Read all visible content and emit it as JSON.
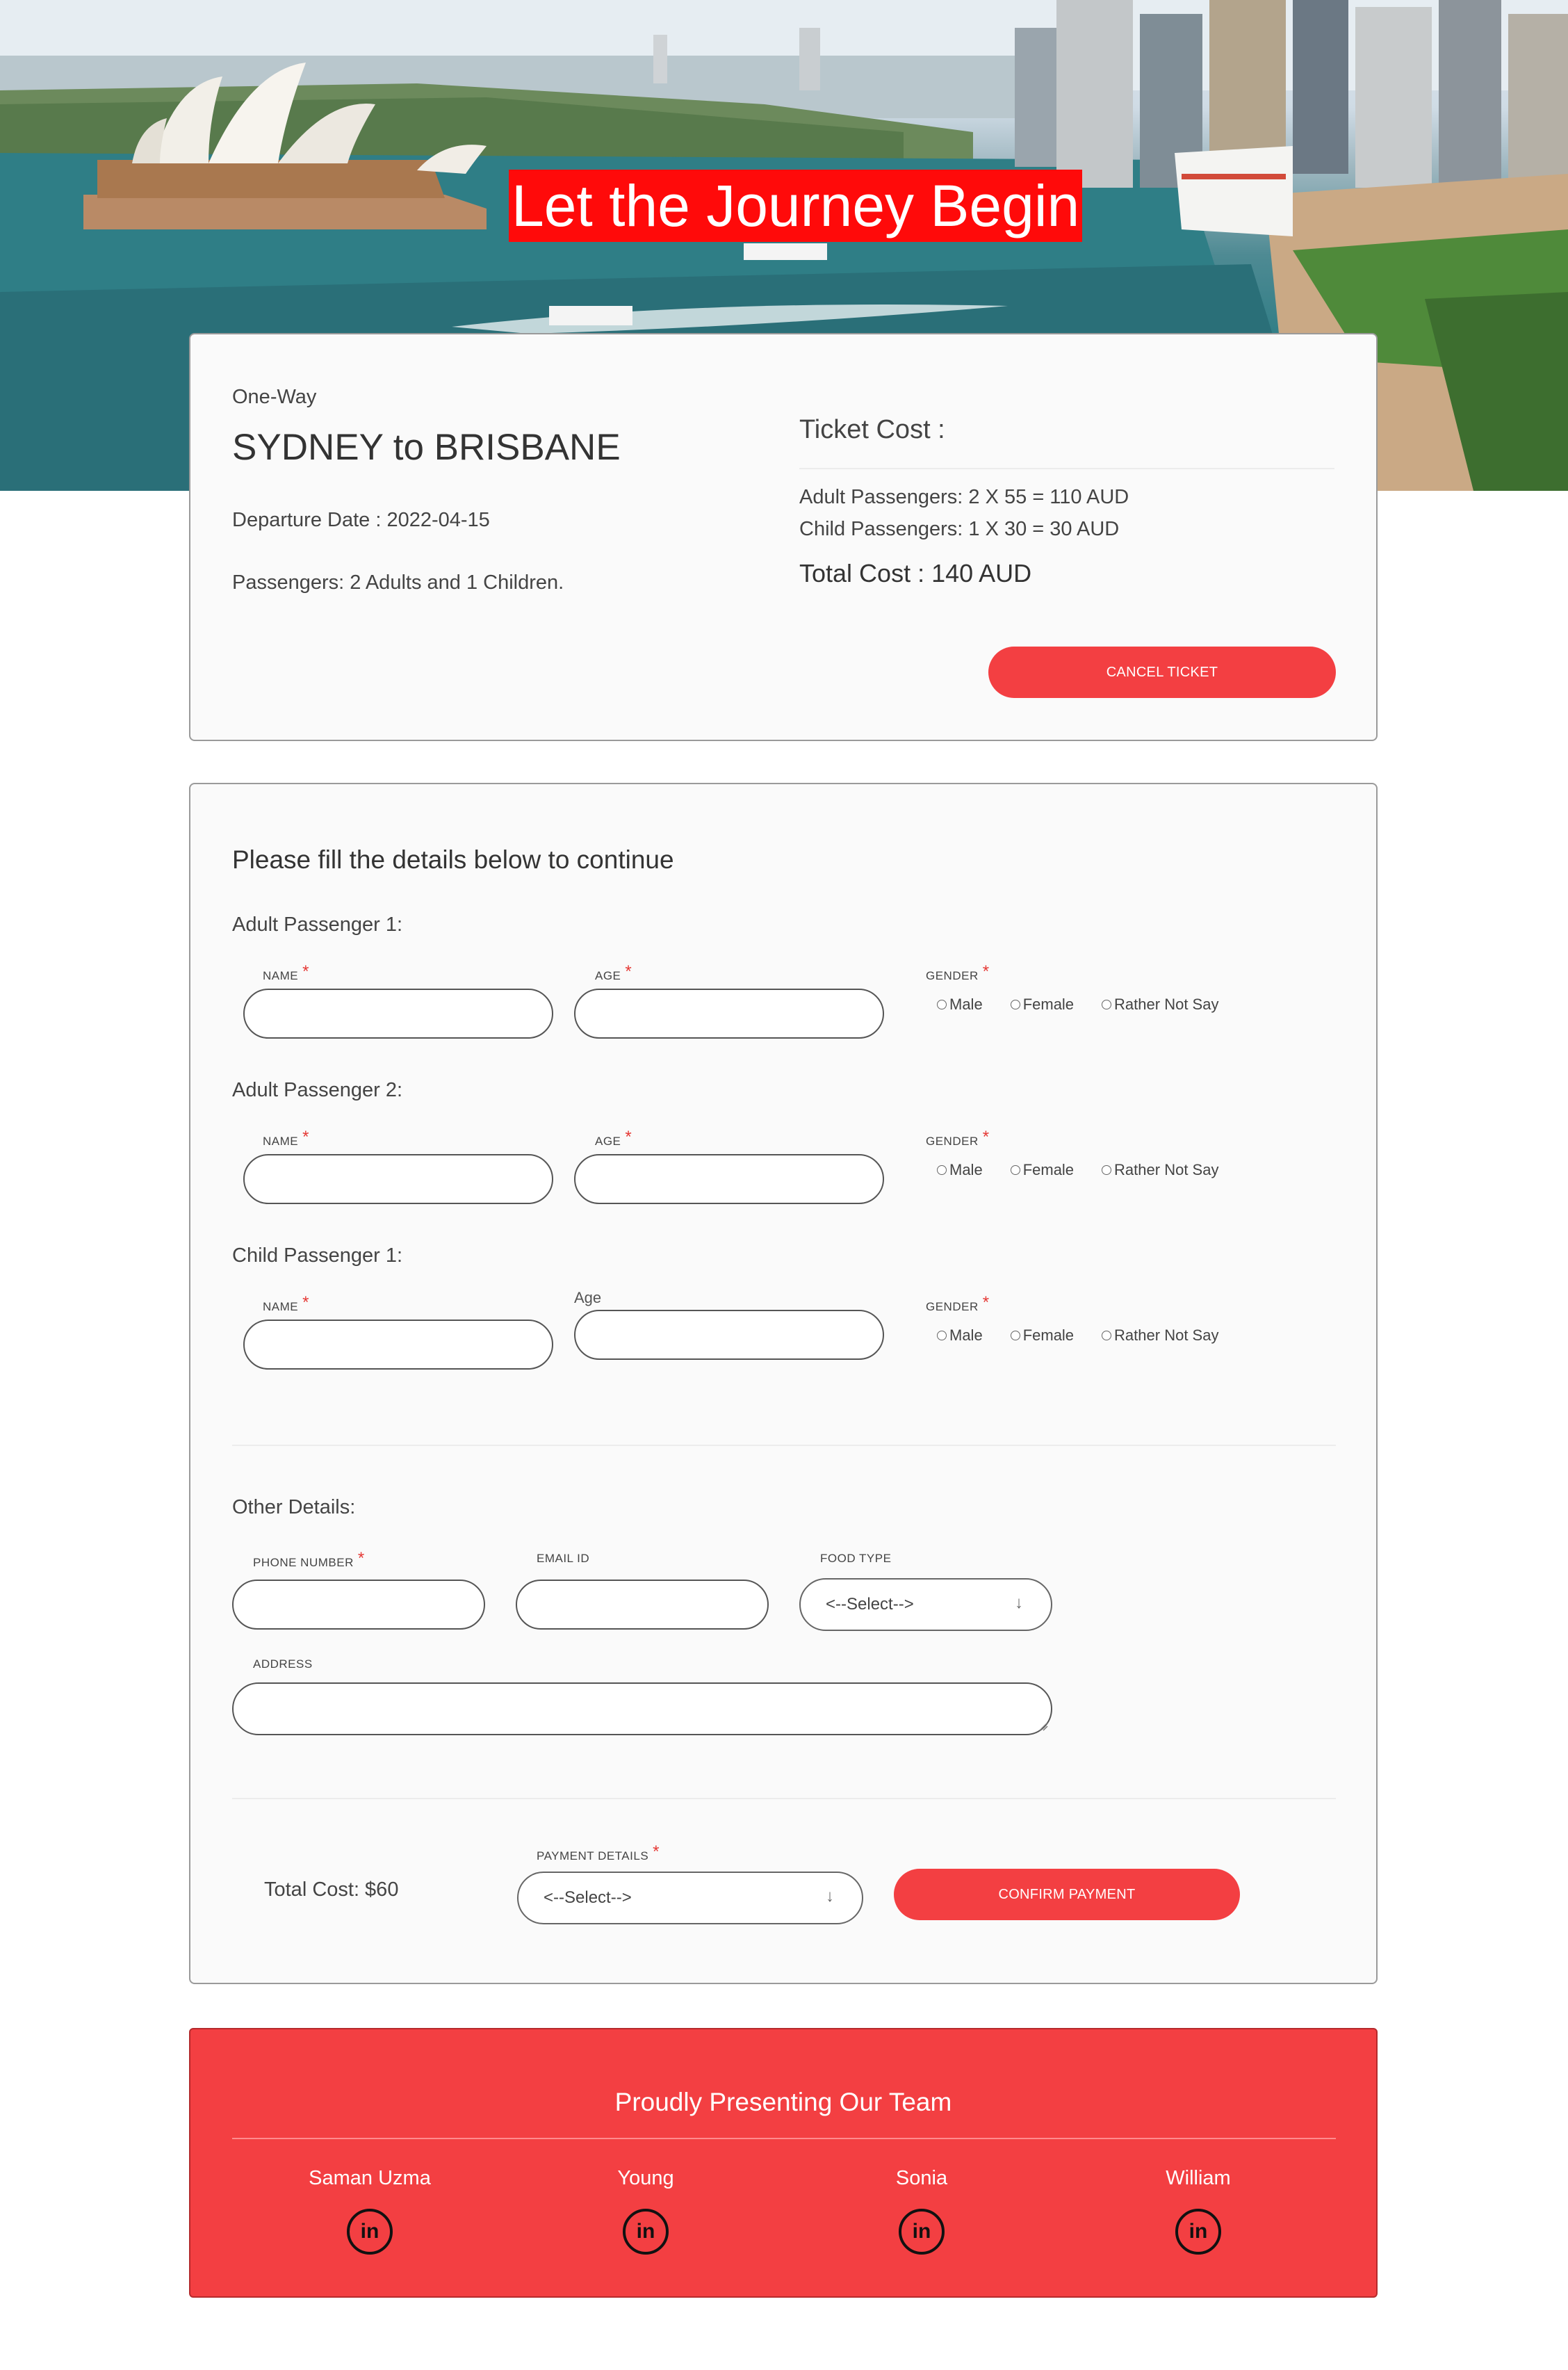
{
  "hero": {
    "title": "Let the Journey Begin"
  },
  "ticket": {
    "trip_type": "One-Way",
    "route": "SYDNEY to BRISBANE",
    "departure": "Departure Date : 2022-04-15",
    "passengers": "Passengers: 2 Adults and 1 Children.",
    "cost_heading": "Ticket Cost :",
    "adult_line": "Adult Passengers: 2 X 55 = 110 AUD",
    "child_line": "Child Passengers: 1 X 30 = 30 AUD",
    "total": "Total Cost : 140 AUD",
    "cancel_label": "CANCEL TICKET"
  },
  "form": {
    "heading": "Please fill the details below to continue",
    "passengers": [
      {
        "title": "Adult Passenger 1:",
        "name_label": "NAME",
        "age_label": "AGE",
        "gender_label": "GENDER"
      },
      {
        "title": "Adult Passenger 2:",
        "name_label": "NAME",
        "age_label": "AGE",
        "gender_label": "GENDER"
      },
      {
        "title": "Child Passenger 1:",
        "name_label": "NAME",
        "age_label": "Age",
        "gender_label": "GENDER"
      }
    ],
    "gender_options": [
      "Male",
      "Female",
      "Rather Not Say"
    ],
    "other": {
      "title": "Other Details:",
      "phone_label": "PHONE NUMBER",
      "email_label": "EMAIL ID",
      "food_label": "FOOD TYPE",
      "food_value": "<--Select-->",
      "address_label": "ADDRESS"
    },
    "payment": {
      "total": "Total Cost: $60",
      "label": "PAYMENT DETAILS",
      "value": "<--Select-->",
      "confirm_label": "CONFIRM PAYMENT"
    }
  },
  "footer": {
    "title": "Proudly Presenting Our Team",
    "members": [
      "Saman Uzma",
      "Young",
      "Sonia",
      "William"
    ],
    "icon_text": "in"
  },
  "colors": {
    "accent": "#f33f42",
    "hero_label": "#ff0a0a"
  }
}
